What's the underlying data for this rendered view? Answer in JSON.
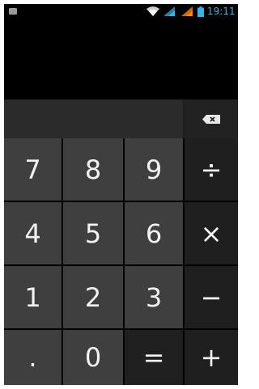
{
  "status_bar": {
    "time": "19:11",
    "icons": [
      "notification-icon",
      "wifi-icon",
      "signal-icon",
      "signal-icon",
      "battery-icon"
    ]
  },
  "display": {
    "result": ""
  },
  "edit": {
    "value": ""
  },
  "keys": {
    "row1": [
      "7",
      "8",
      "9",
      "÷"
    ],
    "row2": [
      "4",
      "5",
      "6",
      "×"
    ],
    "row3": [
      "1",
      "2",
      "3",
      "−"
    ],
    "row4": [
      ".",
      "0",
      "=",
      "+"
    ]
  },
  "colors": {
    "clock": "#33b5e5",
    "signal": "#33b5e5",
    "signal_orange": "#ff8800",
    "number_key_bg": "#3f3f3f",
    "operator_key_bg": "#1f1f1f"
  }
}
